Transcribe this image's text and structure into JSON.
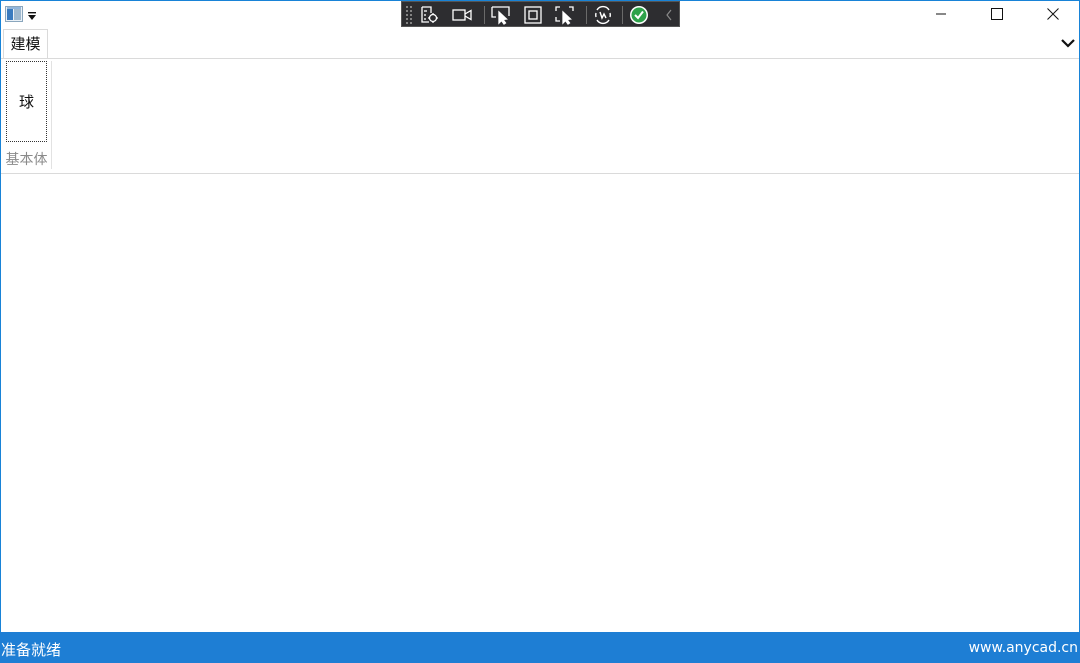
{
  "titlebar": {
    "app_icon": "app-icon",
    "quick_access_icon": "dropdown-triangle-icon",
    "minimize_icon": "minimize-icon",
    "maximize_icon": "maximize-icon",
    "close_icon": "close-icon"
  },
  "debug_toolbar": {
    "buttons": [
      "visual-tree-icon",
      "camera-icon",
      "select-element-icon",
      "display-layout-adorner-icon",
      "track-focus-icon",
      "hot-reload-icon",
      "binding-failures-ok-icon",
      "collapse-chevron-icon"
    ]
  },
  "ribbon": {
    "tabs": [
      {
        "label": "建模"
      }
    ],
    "collapse_icon": "chevron-down-icon",
    "groups": [
      {
        "label": "基本体",
        "buttons": [
          {
            "label": "球"
          }
        ]
      }
    ]
  },
  "statusbar": {
    "left_text": "准备就绪",
    "right_text": "www.anycad.cn",
    "color": "#1e7ed4"
  }
}
